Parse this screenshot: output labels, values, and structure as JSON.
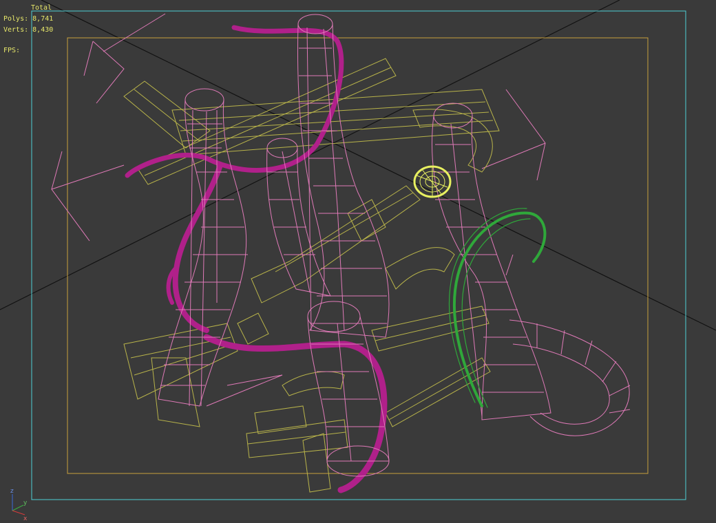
{
  "stats": {
    "header": "Total",
    "polys_label": "Polys:",
    "polys_value": "8,741",
    "verts_label": "Verts:",
    "verts_value": "8,430",
    "fps_label": "FPS:"
  },
  "axis_gizmo": {
    "z": "z",
    "y": "y",
    "x": "x"
  },
  "colors": {
    "background": "#3a3a3a",
    "safe_frame": "#4fd0d6",
    "render_frame": "#c8a03c",
    "wire_pink": "#e07ab8",
    "wire_yellow": "#b9b44a",
    "wire_magenta": "#b0208a",
    "wire_green": "#2fa83a",
    "wire_lime": "#e8f060",
    "grid_line": "#101010",
    "stats_text": "#e8e86a"
  }
}
